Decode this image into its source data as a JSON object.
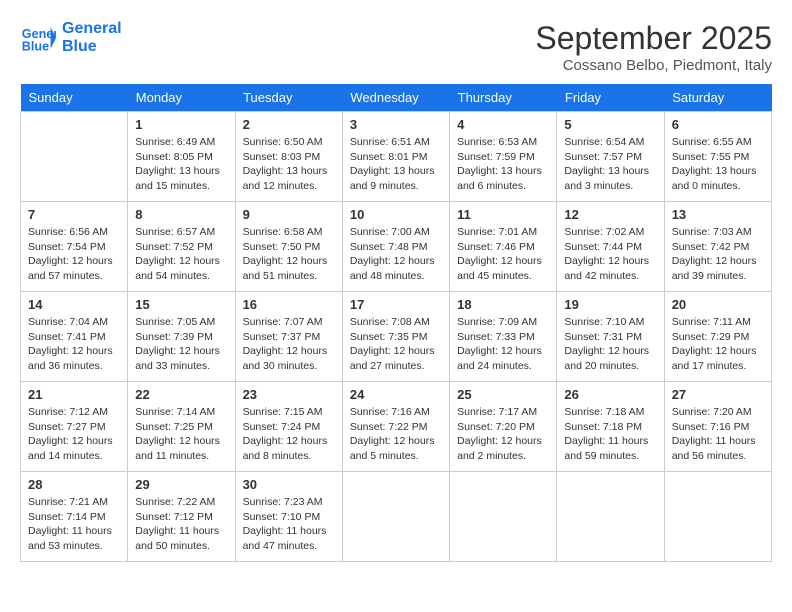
{
  "header": {
    "logo_line1": "General",
    "logo_line2": "Blue",
    "month_title": "September 2025",
    "location": "Cossano Belbo, Piedmont, Italy"
  },
  "days_of_week": [
    "Sunday",
    "Monday",
    "Tuesday",
    "Wednesday",
    "Thursday",
    "Friday",
    "Saturday"
  ],
  "weeks": [
    [
      {
        "day": "",
        "content": ""
      },
      {
        "day": "1",
        "content": "Sunrise: 6:49 AM\nSunset: 8:05 PM\nDaylight: 13 hours\nand 15 minutes."
      },
      {
        "day": "2",
        "content": "Sunrise: 6:50 AM\nSunset: 8:03 PM\nDaylight: 13 hours\nand 12 minutes."
      },
      {
        "day": "3",
        "content": "Sunrise: 6:51 AM\nSunset: 8:01 PM\nDaylight: 13 hours\nand 9 minutes."
      },
      {
        "day": "4",
        "content": "Sunrise: 6:53 AM\nSunset: 7:59 PM\nDaylight: 13 hours\nand 6 minutes."
      },
      {
        "day": "5",
        "content": "Sunrise: 6:54 AM\nSunset: 7:57 PM\nDaylight: 13 hours\nand 3 minutes."
      },
      {
        "day": "6",
        "content": "Sunrise: 6:55 AM\nSunset: 7:55 PM\nDaylight: 13 hours\nand 0 minutes."
      }
    ],
    [
      {
        "day": "7",
        "content": "Sunrise: 6:56 AM\nSunset: 7:54 PM\nDaylight: 12 hours\nand 57 minutes."
      },
      {
        "day": "8",
        "content": "Sunrise: 6:57 AM\nSunset: 7:52 PM\nDaylight: 12 hours\nand 54 minutes."
      },
      {
        "day": "9",
        "content": "Sunrise: 6:58 AM\nSunset: 7:50 PM\nDaylight: 12 hours\nand 51 minutes."
      },
      {
        "day": "10",
        "content": "Sunrise: 7:00 AM\nSunset: 7:48 PM\nDaylight: 12 hours\nand 48 minutes."
      },
      {
        "day": "11",
        "content": "Sunrise: 7:01 AM\nSunset: 7:46 PM\nDaylight: 12 hours\nand 45 minutes."
      },
      {
        "day": "12",
        "content": "Sunrise: 7:02 AM\nSunset: 7:44 PM\nDaylight: 12 hours\nand 42 minutes."
      },
      {
        "day": "13",
        "content": "Sunrise: 7:03 AM\nSunset: 7:42 PM\nDaylight: 12 hours\nand 39 minutes."
      }
    ],
    [
      {
        "day": "14",
        "content": "Sunrise: 7:04 AM\nSunset: 7:41 PM\nDaylight: 12 hours\nand 36 minutes."
      },
      {
        "day": "15",
        "content": "Sunrise: 7:05 AM\nSunset: 7:39 PM\nDaylight: 12 hours\nand 33 minutes."
      },
      {
        "day": "16",
        "content": "Sunrise: 7:07 AM\nSunset: 7:37 PM\nDaylight: 12 hours\nand 30 minutes."
      },
      {
        "day": "17",
        "content": "Sunrise: 7:08 AM\nSunset: 7:35 PM\nDaylight: 12 hours\nand 27 minutes."
      },
      {
        "day": "18",
        "content": "Sunrise: 7:09 AM\nSunset: 7:33 PM\nDaylight: 12 hours\nand 24 minutes."
      },
      {
        "day": "19",
        "content": "Sunrise: 7:10 AM\nSunset: 7:31 PM\nDaylight: 12 hours\nand 20 minutes."
      },
      {
        "day": "20",
        "content": "Sunrise: 7:11 AM\nSunset: 7:29 PM\nDaylight: 12 hours\nand 17 minutes."
      }
    ],
    [
      {
        "day": "21",
        "content": "Sunrise: 7:12 AM\nSunset: 7:27 PM\nDaylight: 12 hours\nand 14 minutes."
      },
      {
        "day": "22",
        "content": "Sunrise: 7:14 AM\nSunset: 7:25 PM\nDaylight: 12 hours\nand 11 minutes."
      },
      {
        "day": "23",
        "content": "Sunrise: 7:15 AM\nSunset: 7:24 PM\nDaylight: 12 hours\nand 8 minutes."
      },
      {
        "day": "24",
        "content": "Sunrise: 7:16 AM\nSunset: 7:22 PM\nDaylight: 12 hours\nand 5 minutes."
      },
      {
        "day": "25",
        "content": "Sunrise: 7:17 AM\nSunset: 7:20 PM\nDaylight: 12 hours\nand 2 minutes."
      },
      {
        "day": "26",
        "content": "Sunrise: 7:18 AM\nSunset: 7:18 PM\nDaylight: 11 hours\nand 59 minutes."
      },
      {
        "day": "27",
        "content": "Sunrise: 7:20 AM\nSunset: 7:16 PM\nDaylight: 11 hours\nand 56 minutes."
      }
    ],
    [
      {
        "day": "28",
        "content": "Sunrise: 7:21 AM\nSunset: 7:14 PM\nDaylight: 11 hours\nand 53 minutes."
      },
      {
        "day": "29",
        "content": "Sunrise: 7:22 AM\nSunset: 7:12 PM\nDaylight: 11 hours\nand 50 minutes."
      },
      {
        "day": "30",
        "content": "Sunrise: 7:23 AM\nSunset: 7:10 PM\nDaylight: 11 hours\nand 47 minutes."
      },
      {
        "day": "",
        "content": ""
      },
      {
        "day": "",
        "content": ""
      },
      {
        "day": "",
        "content": ""
      },
      {
        "day": "",
        "content": ""
      }
    ]
  ]
}
